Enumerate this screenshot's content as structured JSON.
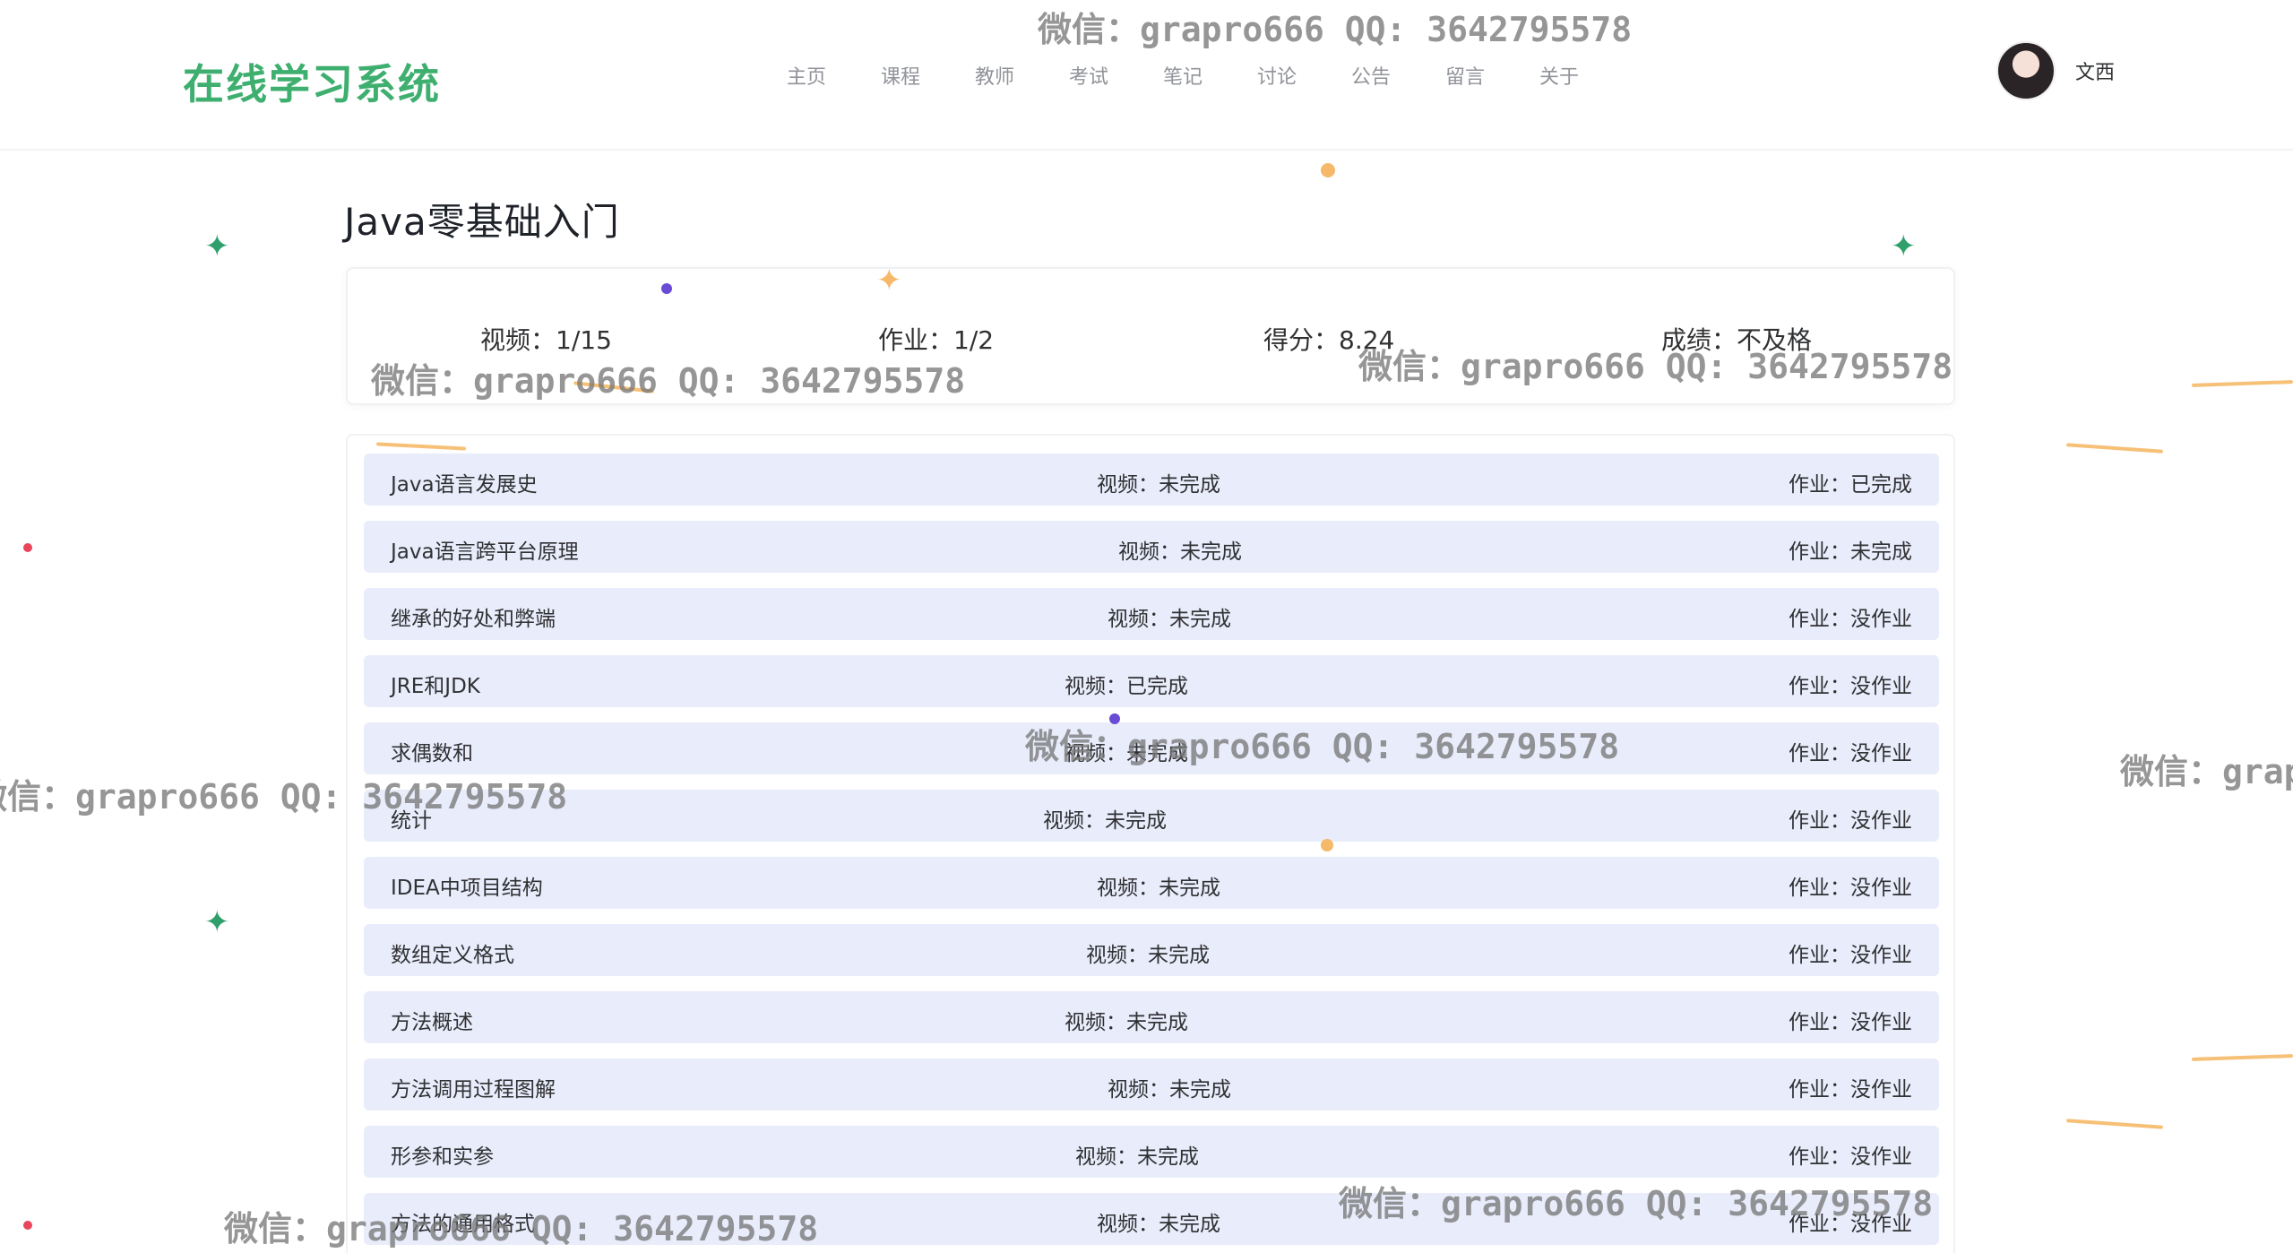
{
  "header": {
    "logo": "在线学习系统",
    "nav": [
      "主页",
      "课程",
      "教师",
      "考试",
      "笔记",
      "讨论",
      "公告",
      "留言",
      "关于"
    ],
    "username": "文西"
  },
  "course": {
    "title": "Java零基础入门",
    "summary": {
      "video": "视频：1/15",
      "homework": "作业：1/2",
      "score": "得分：8.24",
      "grade": "成绩：不及格"
    }
  },
  "lessons": [
    {
      "name": "Java语言发展史",
      "video": "视频：未完成",
      "homework": "作业：已完成"
    },
    {
      "name": "Java语言跨平台原理",
      "video": "视频：未完成",
      "homework": "作业：未完成"
    },
    {
      "name": "继承的好处和弊端",
      "video": "视频：未完成",
      "homework": "作业：没作业"
    },
    {
      "name": "JRE和JDK",
      "video": "视频：已完成",
      "homework": "作业：没作业"
    },
    {
      "name": "求偶数和",
      "video": "视频：未完成",
      "homework": "作业：没作业"
    },
    {
      "name": "统计",
      "video": "视频：未完成",
      "homework": "作业：没作业"
    },
    {
      "name": "IDEA中项目结构",
      "video": "视频：未完成",
      "homework": "作业：没作业"
    },
    {
      "name": "数组定义格式",
      "video": "视频：未完成",
      "homework": "作业：没作业"
    },
    {
      "name": "方法概述",
      "video": "视频：未完成",
      "homework": "作业：没作业"
    },
    {
      "name": "方法调用过程图解",
      "video": "视频：未完成",
      "homework": "作业：没作业"
    },
    {
      "name": "形参和实参",
      "video": "视频：未完成",
      "homework": "作业：没作业"
    },
    {
      "name": "方法的通用格式",
      "video": "视频：未完成",
      "homework": "作业：没作业"
    }
  ],
  "watermark": "微信：grapro666 QQ: 3642795578",
  "colors": {
    "brand": "#3eaf6f",
    "row_bg": "#e9ecfb",
    "nav_text": "#909399"
  },
  "icons": {
    "avatar": "user-avatar-photo",
    "decorations": [
      "sparkle-star",
      "dot",
      "curve-dash"
    ]
  }
}
